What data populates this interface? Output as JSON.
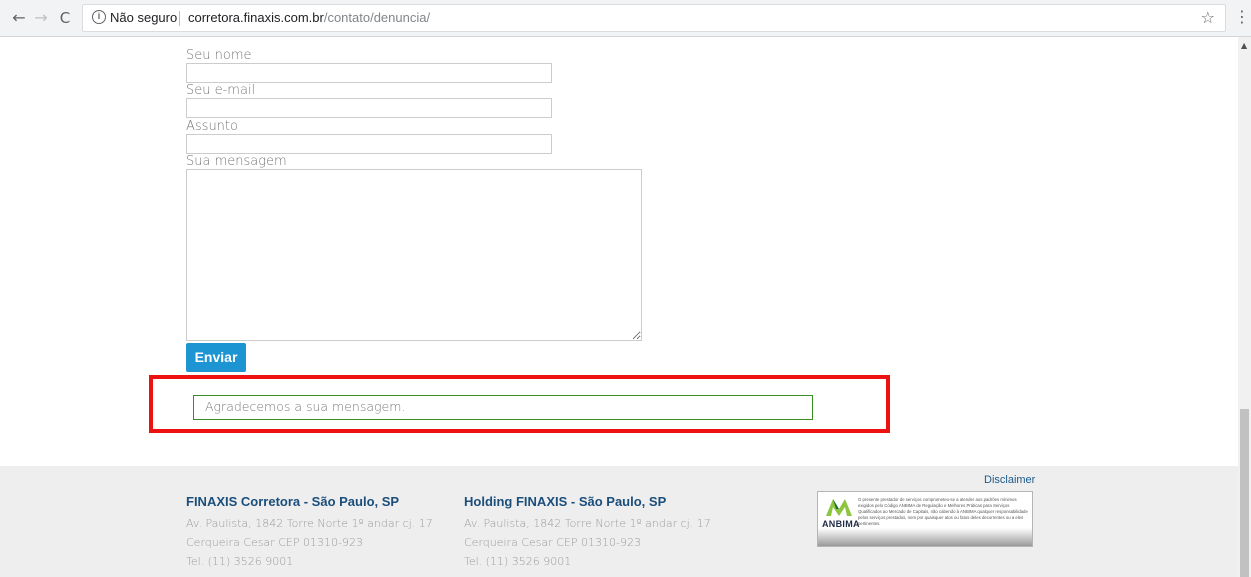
{
  "browser": {
    "secure_label": "Não seguro",
    "url_host": "corretora.finaxis.com.br",
    "url_path": "/contato/denuncia/"
  },
  "form": {
    "name_label": "Seu nome",
    "email_label": "Seu e-mail",
    "subject_label": "Assunto",
    "message_label": "Sua mensagem",
    "name_value": "",
    "email_value": "",
    "subject_value": "",
    "message_value": "",
    "submit_label": "Enviar",
    "success_message": "Agradecemos a sua mensagem."
  },
  "footer": {
    "disclaimer": "Disclaimer",
    "col1": {
      "title": "FINAXIS Corretora - São Paulo, SP",
      "address1": "Av. Paulista, 1842 Torre Norte 1º andar cj. 17",
      "address2": "Cerqueira Cesar CEP 01310-923",
      "phone": "Tel. (11) 3526 9001"
    },
    "col2": {
      "title": "Holding FINAXIS - São Paulo, SP",
      "address1": "Av. Paulista, 1842 Torre Norte 1º andar cj. 17",
      "address2": "Cerqueira Cesar CEP 01310-923",
      "phone": "Tel. (11) 3526 9001"
    },
    "anbima": {
      "name": "ANBIMA",
      "text": "O presente prestador de serviços comprometeu-se a atender aos padrões mínimos exigidos pelo Código ANBIMA de Regulação e Melhores Práticas para Serviços Qualificados ao Mercado de Capitais, não cabendo à ANBIMA qualquer responsabilidade pelos serviços prestados, nem por quaisquer atos ou fatos deles decorrentes ou a eles pertinentes."
    }
  },
  "colors": {
    "button": "#1e95d3",
    "highlight": "#ee1111",
    "success_border": "#3a8f24",
    "footer_title": "#1b4e7a"
  },
  "icons": [
    "back-arrow-icon",
    "forward-arrow-icon",
    "reload-icon",
    "info-icon",
    "star-icon",
    "menu-dots-icon"
  ]
}
